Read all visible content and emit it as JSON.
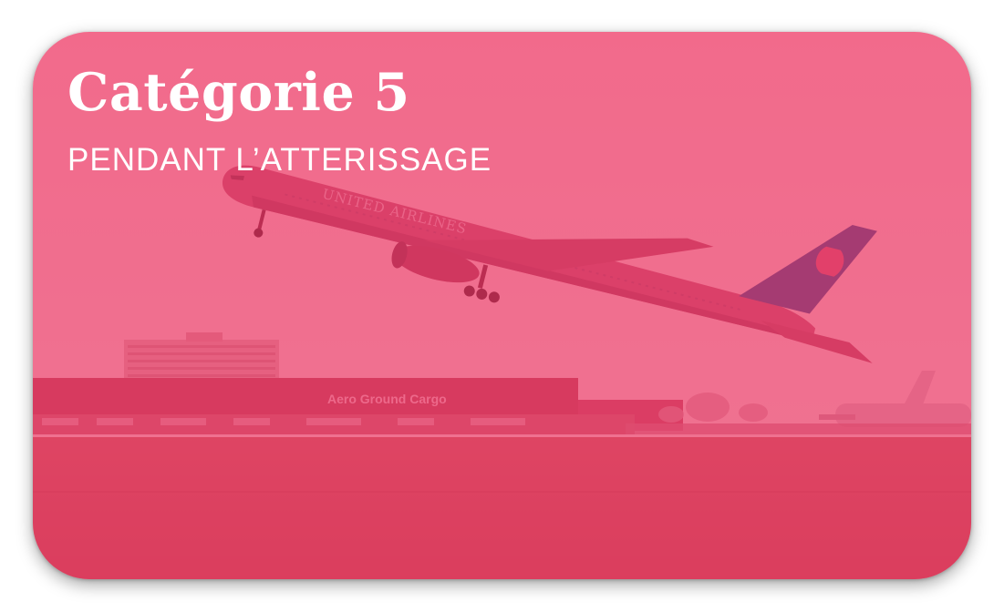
{
  "card": {
    "title": "Catégorie 5",
    "subtitle": "PENDANT L’ATTERISSAGE",
    "image": {
      "airline_livery": "UNITED AIRLINES",
      "building_sign": "Aero Ground Cargo"
    },
    "overlay_color": "#f03868"
  }
}
